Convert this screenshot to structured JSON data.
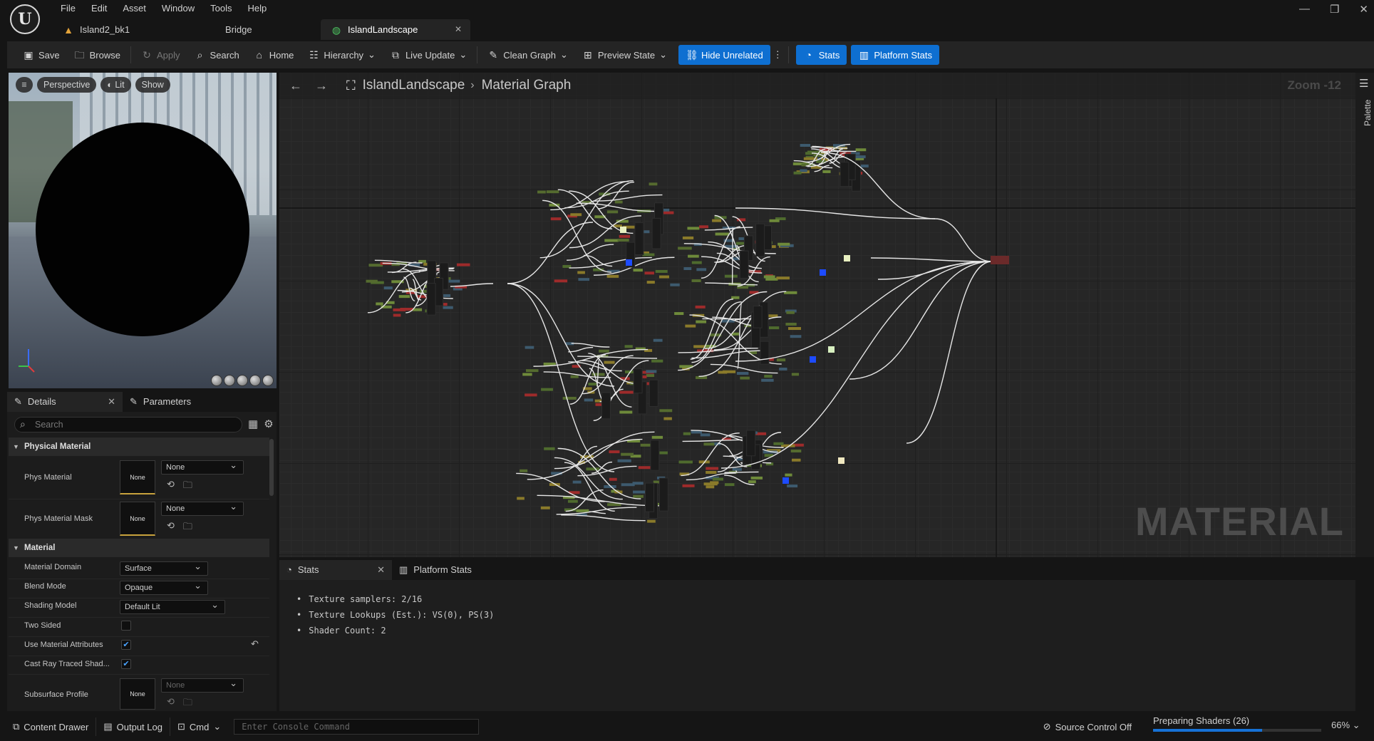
{
  "menu": [
    "File",
    "Edit",
    "Asset",
    "Window",
    "Tools",
    "Help"
  ],
  "doc_tabs": [
    {
      "label": "Island2_bk1"
    },
    {
      "label": "Bridge"
    },
    {
      "label": "IslandLandscape",
      "active": true
    }
  ],
  "toolbar": {
    "save": "Save",
    "browse": "Browse",
    "apply": "Apply",
    "search": "Search",
    "home": "Home",
    "hierarchy": "Hierarchy",
    "live_update": "Live Update",
    "clean_graph": "Clean Graph",
    "preview_state": "Preview State",
    "hide_unrelated": "Hide Unrelated",
    "stats": "Stats",
    "platform_stats": "Platform Stats"
  },
  "viewport": {
    "perspective": "Perspective",
    "lit": "Lit",
    "show": "Show"
  },
  "details": {
    "tab_details": "Details",
    "tab_parameters": "Parameters",
    "search_placeholder": "Search",
    "section_physical": "Physical Material",
    "phys_material_label": "Phys Material",
    "phys_material_thumb": "None",
    "phys_material_value": "None",
    "phys_mask_label": "Phys Material Mask",
    "phys_mask_thumb": "None",
    "phys_mask_value": "None",
    "section_material": "Material",
    "domain_label": "Material Domain",
    "domain_value": "Surface",
    "blend_label": "Blend Mode",
    "blend_value": "Opaque",
    "shading_label": "Shading Model",
    "shading_value": "Default Lit",
    "two_sided_label": "Two Sided",
    "two_sided": false,
    "use_attr_label": "Use Material Attributes",
    "use_attr": true,
    "cast_rt_label": "Cast Ray Traced Shad...",
    "cast_rt": true,
    "subsurface_label": "Subsurface Profile",
    "subsurface_thumb": "None",
    "subsurface_value": "None"
  },
  "graph": {
    "crumb_asset": "IslandLandscape",
    "crumb_graph": "Material Graph",
    "zoom": "Zoom -12",
    "watermark": "MATERIAL",
    "palette": "Palette"
  },
  "stats": {
    "tab_stats": "Stats",
    "tab_platform": "Platform Stats",
    "lines": [
      "Texture samplers: 2/16",
      "Texture Lookups (Est.): VS(0), PS(3)",
      "Shader Count: 2"
    ]
  },
  "statusbar": {
    "content_drawer": "Content Drawer",
    "output_log": "Output Log",
    "cmd": "Cmd",
    "console_placeholder": "Enter Console Command",
    "source_control": "Source Control Off",
    "preparing": "Preparing Shaders (26)",
    "progress": 0.65,
    "zoom_pct": "66%"
  },
  "colors": {
    "accent_blue": "#0e6fd1",
    "wire": "#e8e8e8",
    "progress": "#1672d6"
  }
}
